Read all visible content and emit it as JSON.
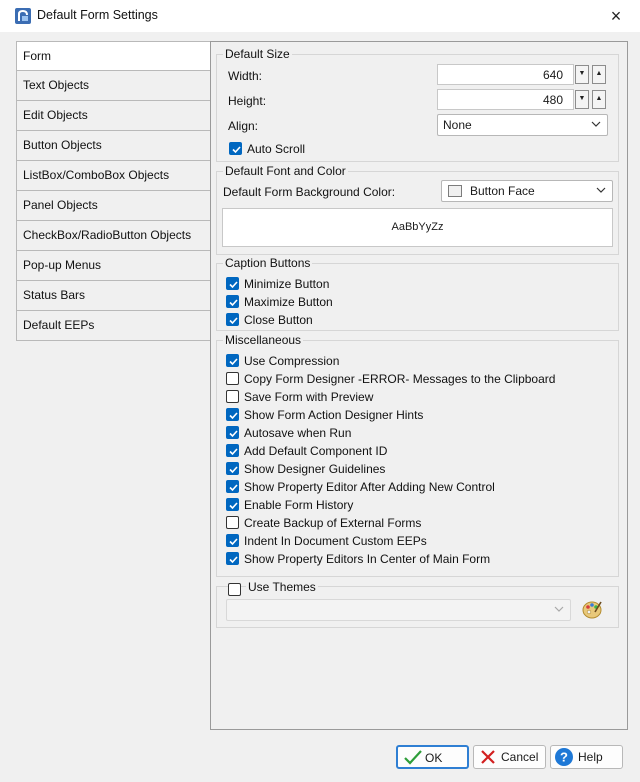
{
  "window": {
    "title": "Default Form Settings",
    "close_glyph": "×"
  },
  "tabs": [
    {
      "label": "Form"
    },
    {
      "label": "Text Objects"
    },
    {
      "label": "Edit Objects"
    },
    {
      "label": "Button Objects"
    },
    {
      "label": "ListBox/ComboBox Objects"
    },
    {
      "label": "Panel Objects"
    },
    {
      "label": "CheckBox/RadioButton Objects"
    },
    {
      "label": "Pop-up Menus"
    },
    {
      "label": "Status Bars"
    },
    {
      "label": "Default EEPs"
    }
  ],
  "default_size": {
    "title": "Default Size",
    "width_label": "Width:",
    "width_value": "640",
    "height_label": "Height:",
    "height_value": "480",
    "align_label": "Align:",
    "align_value": "None",
    "auto_scroll_label": "Auto Scroll",
    "auto_scroll_checked": true
  },
  "font_color": {
    "title": "Default Font and Color",
    "bg_label": "Default Form Background Color:",
    "bg_value": "Button Face",
    "swatch_color": "#f0f0f0",
    "sample_text": "AaBbYyZz"
  },
  "caption_buttons": {
    "title": "Caption Buttons",
    "items": [
      {
        "label": "Minimize Button",
        "checked": true
      },
      {
        "label": "Maximize Button",
        "checked": true
      },
      {
        "label": "Close Button",
        "checked": true
      }
    ]
  },
  "misc": {
    "title": "Miscellaneous",
    "items": [
      {
        "label": "Use Compression",
        "checked": true
      },
      {
        "label": "Copy Form Designer -ERROR- Messages to the Clipboard",
        "checked": false
      },
      {
        "label": "Save Form with Preview",
        "checked": false
      },
      {
        "label": "Show Form Action Designer Hints",
        "checked": true
      },
      {
        "label": "Autosave when Run",
        "checked": true
      },
      {
        "label": "Add Default Component ID",
        "checked": true
      },
      {
        "label": "Show Designer Guidelines",
        "checked": true
      },
      {
        "label": "Show Property Editor After Adding New Control",
        "checked": true
      },
      {
        "label": "Enable Form History",
        "checked": true
      },
      {
        "label": "Create Backup of External Forms",
        "checked": false
      },
      {
        "label": "Indent In Document Custom EEPs",
        "checked": true
      },
      {
        "label": "Show Property Editors In Center of Main Form",
        "checked": true
      }
    ]
  },
  "themes": {
    "label": "Use Themes",
    "checked": false,
    "value": ""
  },
  "buttons": {
    "ok": "OK",
    "cancel": "Cancel",
    "help": "Help"
  },
  "colors": {
    "accent": "#0067c0",
    "ok_check": "#2e9e3a",
    "cancel_x": "#d21f1f",
    "help_blue": "#1e78d6"
  }
}
